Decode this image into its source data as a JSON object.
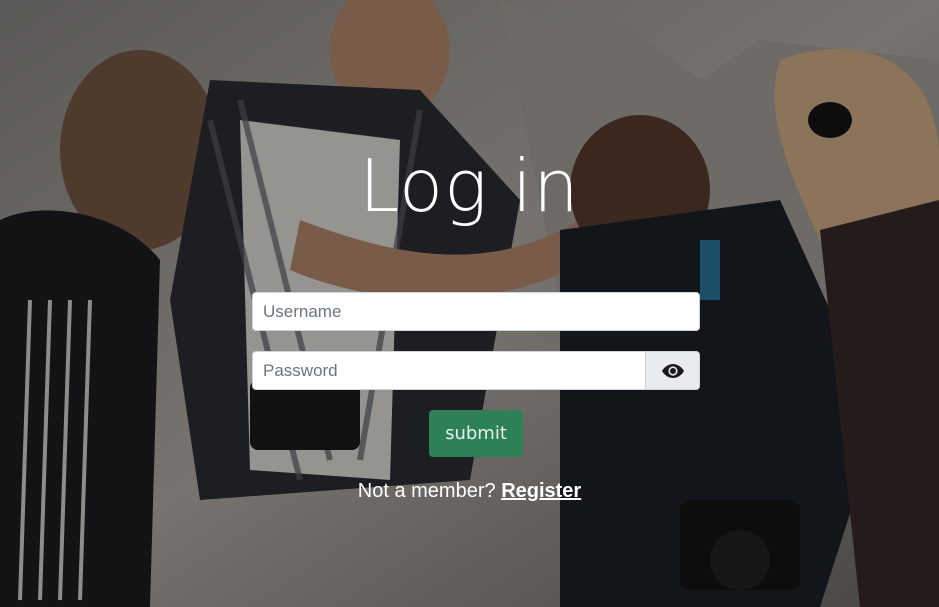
{
  "page": {
    "title": "Log in"
  },
  "form": {
    "username_placeholder": "Username",
    "password_placeholder": "Password",
    "toggle_icon": "eye-icon",
    "submit_label": "submit"
  },
  "footer": {
    "prompt": "Not a member?",
    "register_link": "Register"
  },
  "colors": {
    "submit_bg": "#2e8057",
    "overlay": "rgba(0,0,0,0.35)",
    "text": "#ffffff"
  }
}
